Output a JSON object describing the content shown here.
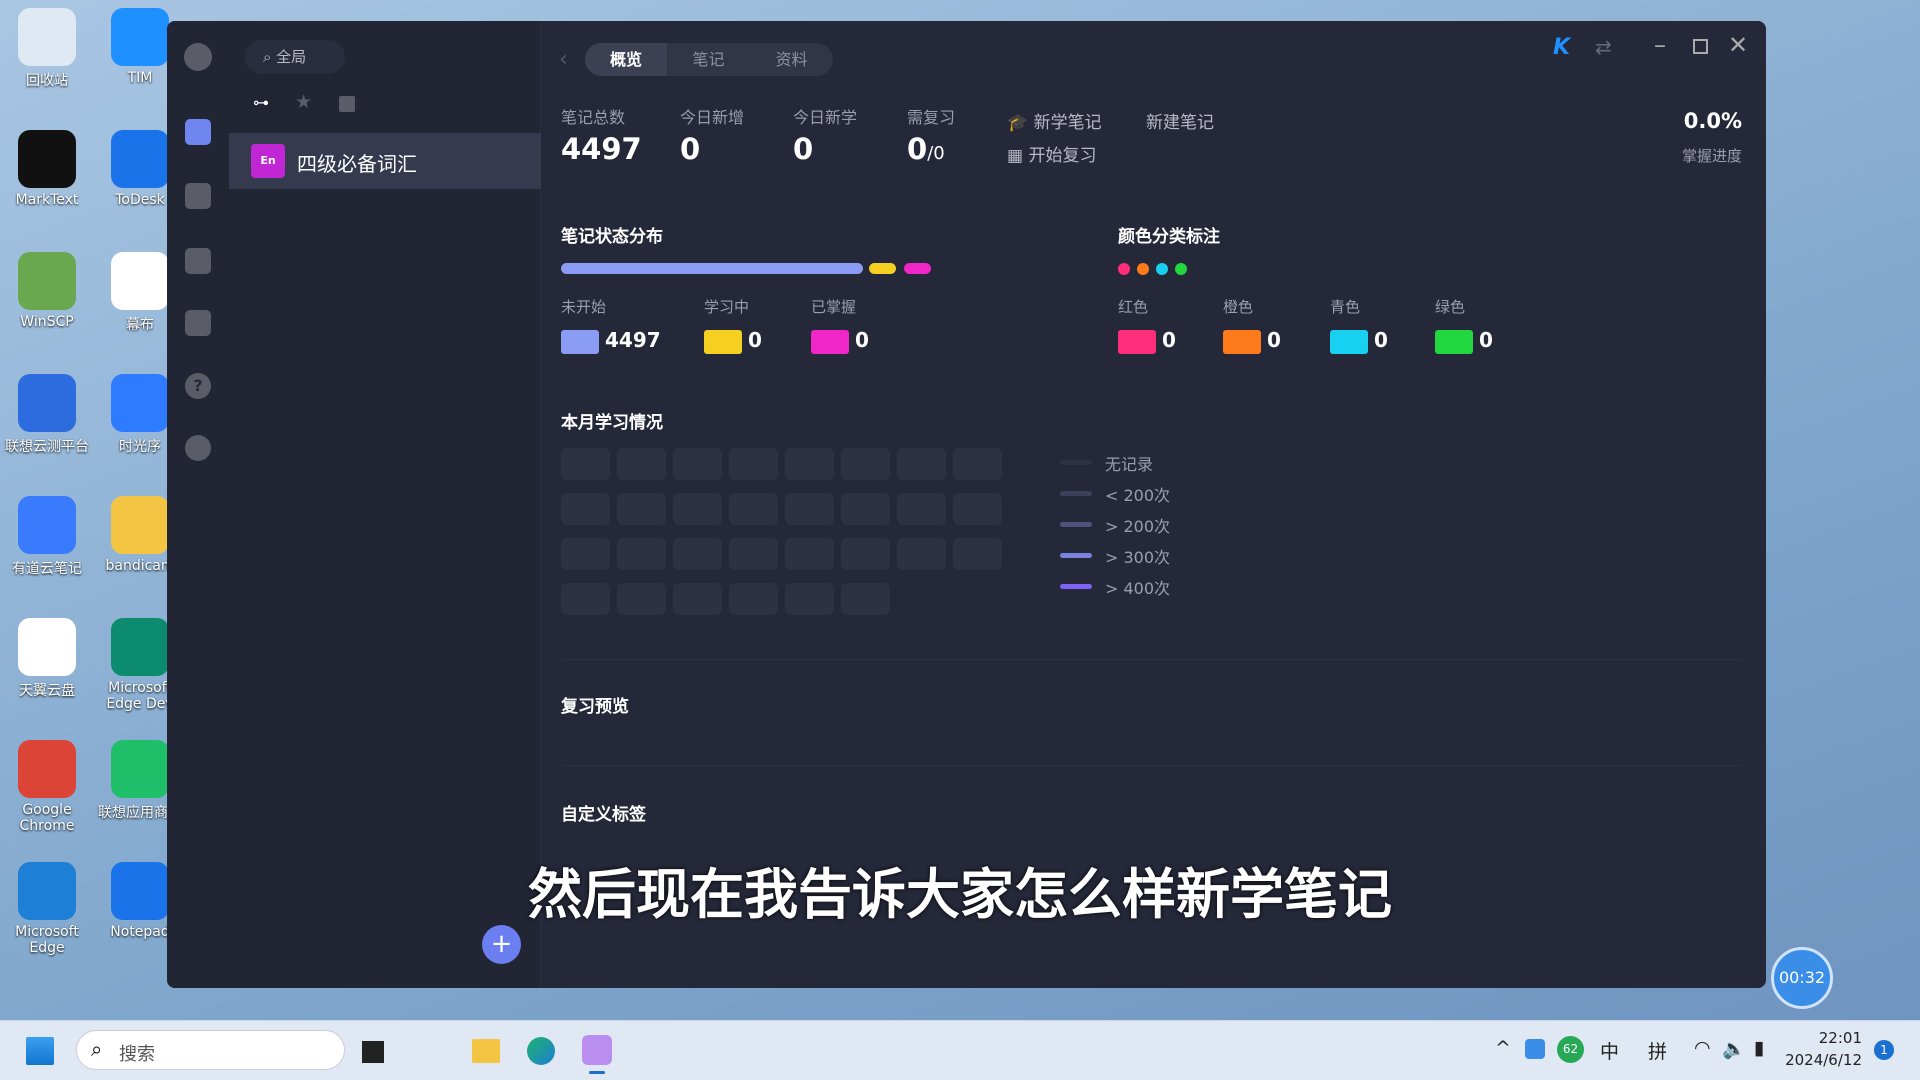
{
  "desktop": {
    "icons": [
      {
        "label": "回收站",
        "color": "#dfe9f3"
      },
      {
        "label": "TIM",
        "color": "#1e90ff"
      },
      {
        "label": "MarkText",
        "color": "#111111"
      },
      {
        "label": "ToDesk",
        "color": "#1a73e8"
      },
      {
        "label": "WinSCP",
        "color": "#6aa84f"
      },
      {
        "label": "幕布",
        "color": "#ffffff"
      },
      {
        "label": "联想云测平台",
        "color": "#2d6cdf"
      },
      {
        "label": "时光序",
        "color": "#2f7bff"
      },
      {
        "label": "有道云笔记",
        "color": "#3a7bfd"
      },
      {
        "label": "bandicam",
        "color": "#f4c542"
      },
      {
        "label": "天翼云盘",
        "color": "#ffffff"
      },
      {
        "label": "Microsoft Edge Dev",
        "color": "#0c8b6f"
      },
      {
        "label": "Google Chrome",
        "color": "#db4437"
      },
      {
        "label": "联想应用商店",
        "color": "#1fbf6a"
      },
      {
        "label": "Microsoft Edge",
        "color": "#1d7fd6"
      },
      {
        "label": "Notepad",
        "color": "#1a73e8"
      }
    ]
  },
  "window": {
    "search": {
      "label": "全局"
    },
    "tabs": [
      {
        "label": "概览",
        "active": true
      },
      {
        "label": "笔记"
      },
      {
        "label": "资料"
      }
    ],
    "notebook": {
      "badge": "En",
      "name": "四级必备词汇",
      "badge_color": "#c026d3"
    },
    "stats": [
      {
        "label": "笔记总数",
        "value": "4497"
      },
      {
        "label": "今日新增",
        "value": "0"
      },
      {
        "label": "今日新学",
        "value": "0"
      },
      {
        "label": "需复习",
        "value": "0",
        "suffix": "/0"
      }
    ],
    "actions": {
      "learn": "新学笔记",
      "create": "新建笔记",
      "review": "开始复习"
    },
    "progress": {
      "value": "0.0%",
      "label": "掌握进度"
    },
    "status": {
      "title": "笔记状态分布",
      "items": [
        {
          "label": "未开始",
          "value": "4497",
          "color": "#8b9cf4"
        },
        {
          "label": "学习中",
          "value": "0",
          "color": "#f5d020"
        },
        {
          "label": "已掌握",
          "value": "0",
          "color": "#f026c8"
        }
      ]
    },
    "colors": {
      "title": "颜色分类标注",
      "items": [
        {
          "label": "红色",
          "value": "0",
          "color": "#ff2d7a"
        },
        {
          "label": "橙色",
          "value": "0",
          "color": "#ff7a1a"
        },
        {
          "label": "青色",
          "value": "0",
          "color": "#18d0f0"
        },
        {
          "label": "绿色",
          "value": "0",
          "color": "#22d640"
        }
      ]
    },
    "monthly": {
      "title": "本月学习情况",
      "days": 30,
      "legend": [
        {
          "label": "无记录",
          "color": "#2e3142"
        },
        {
          "label": "< 200次",
          "color": "#3c3f58"
        },
        {
          "label": "> 200次",
          "color": "#50527e"
        },
        {
          "label": "> 300次",
          "color": "#7a82e0"
        },
        {
          "label": "> 400次",
          "color": "#7d63f5"
        }
      ]
    },
    "review_preview": {
      "title": "复习预览"
    },
    "custom_tags": {
      "title": "自定义标签"
    },
    "accent": "#1e90ff"
  },
  "subtitle": "然后现在我告诉大家怎么样新学笔记",
  "timer": "00:32",
  "taskbar": {
    "search": "搜索",
    "ime1": "中",
    "ime2": "拼",
    "badge": "62",
    "time": "22:01",
    "date": "2024/6/12",
    "notif": "1"
  }
}
